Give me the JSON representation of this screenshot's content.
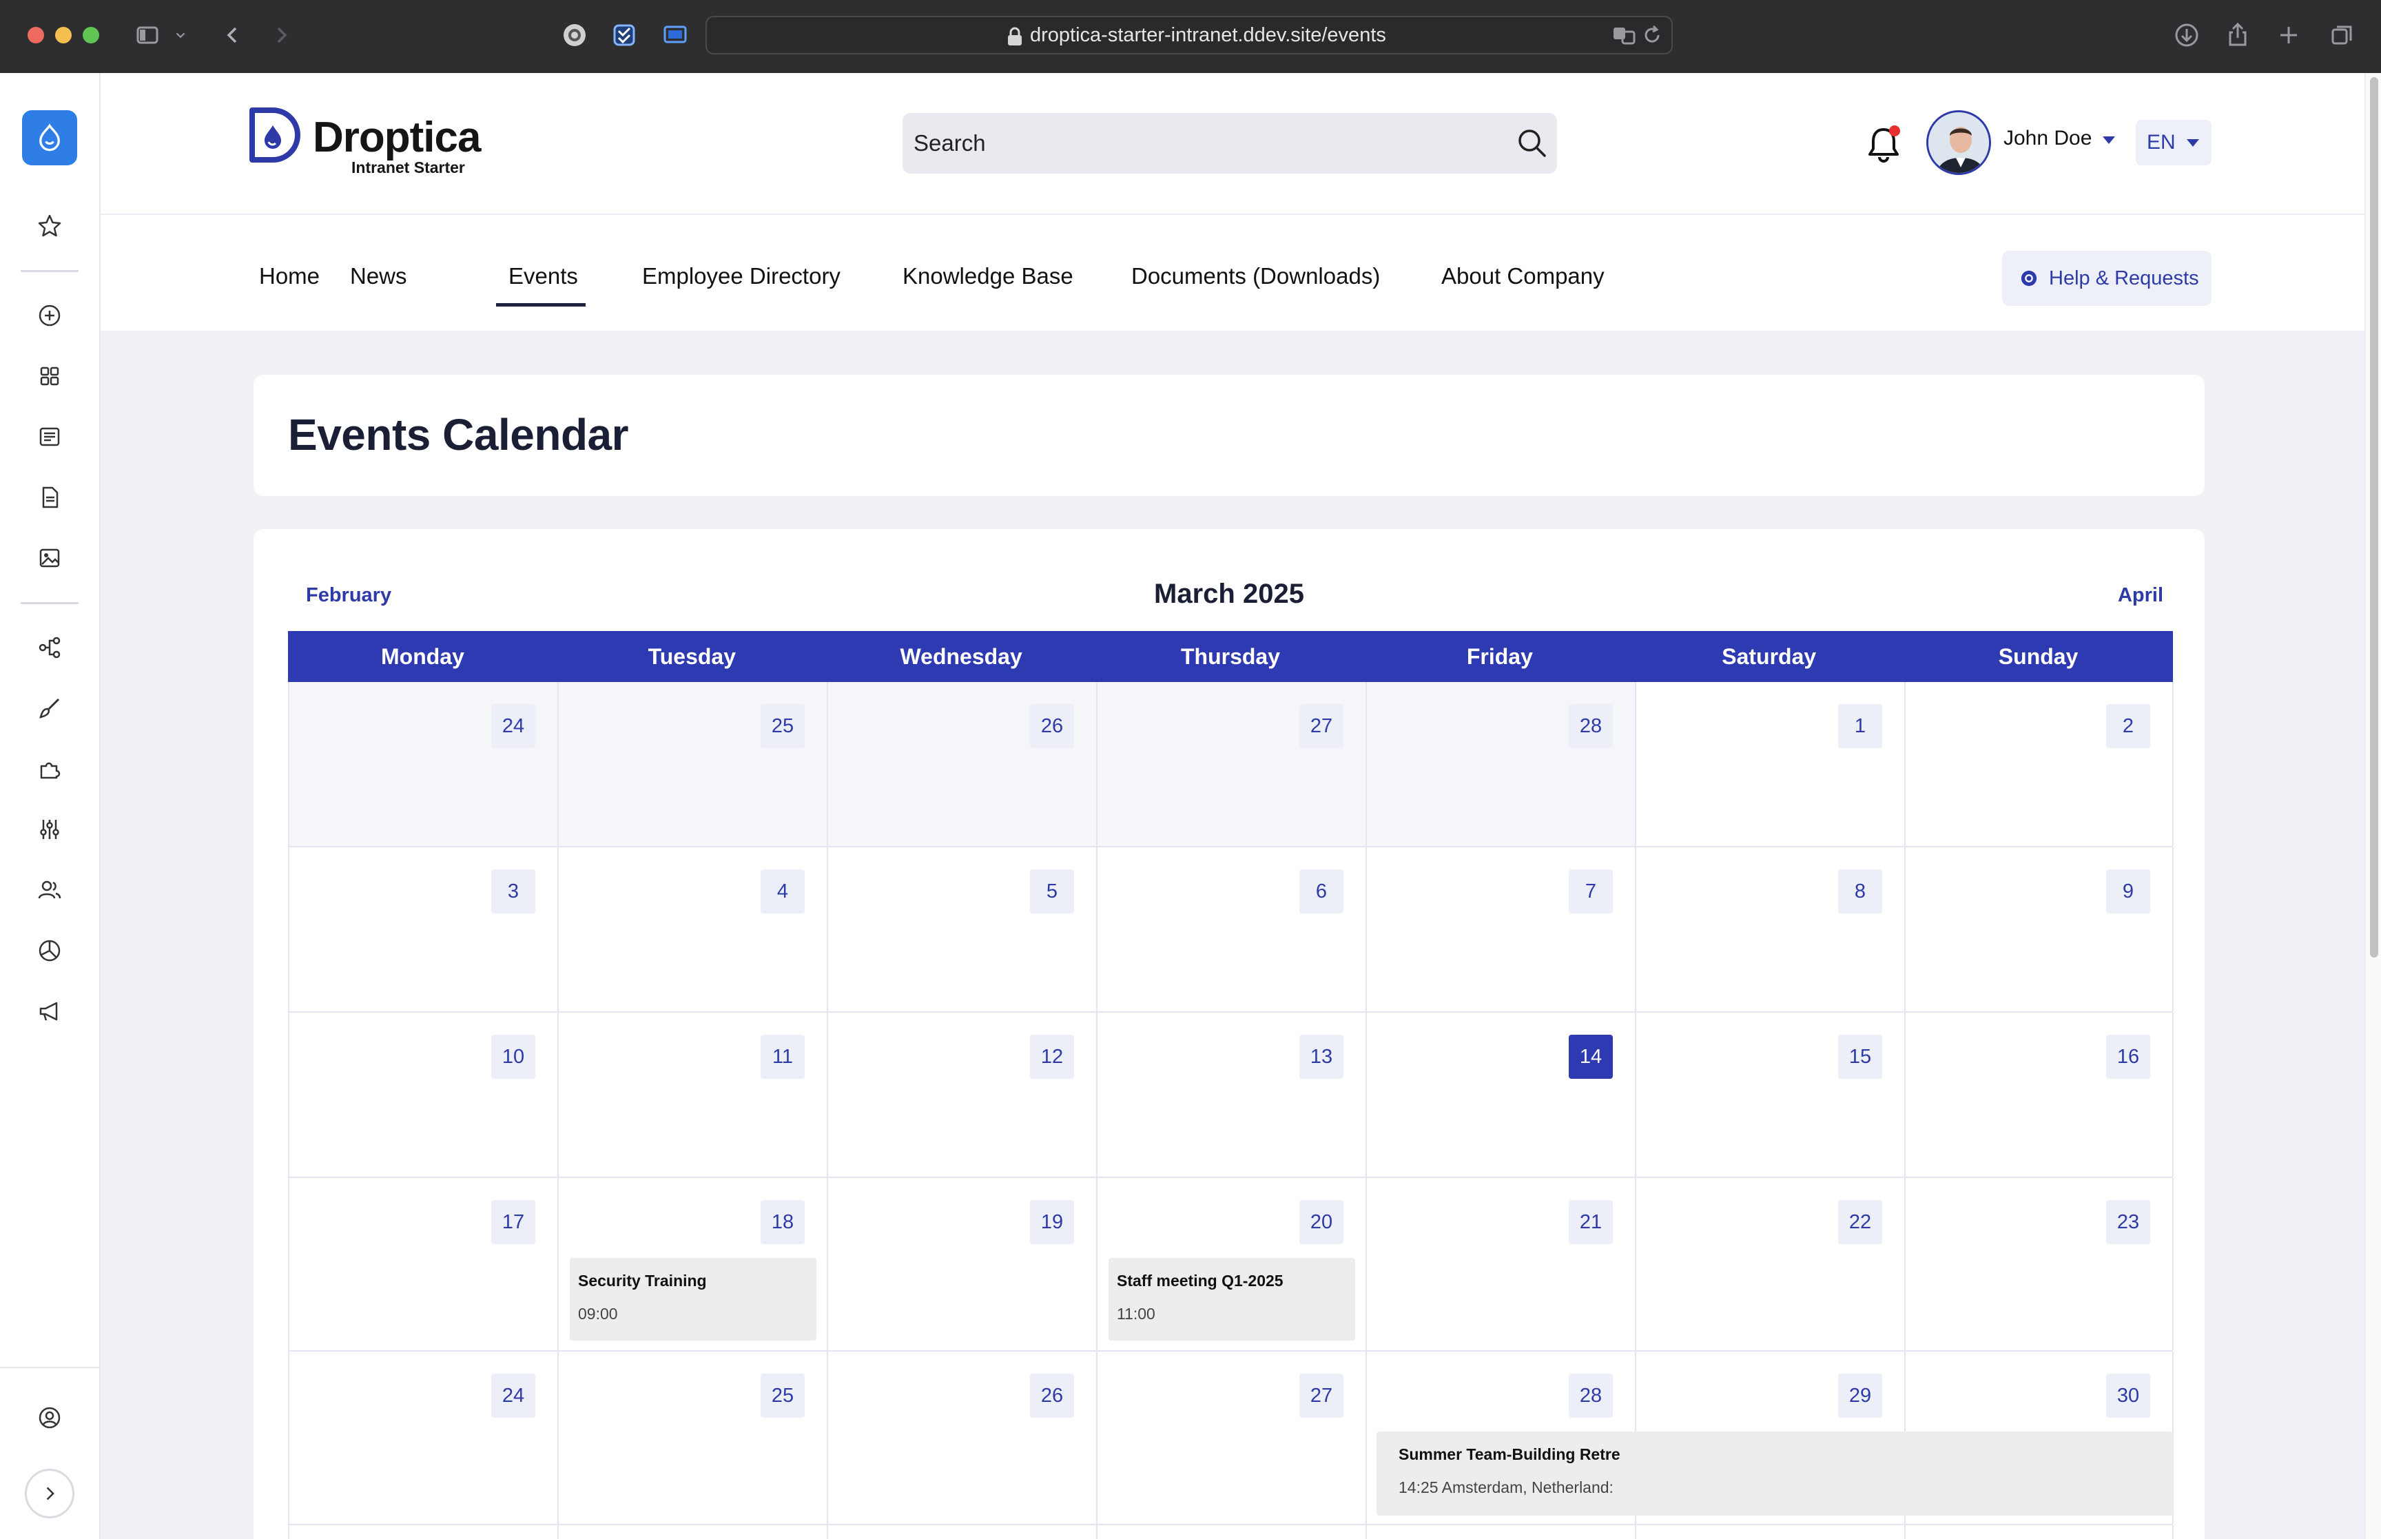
{
  "browser": {
    "url": "droptica-starter-intranet.ddev.site/events",
    "colors": {
      "chrome_bg": "#2e2e30",
      "close": "#ed6a5e",
      "minimize": "#f5bf4f",
      "zoom": "#61c554"
    }
  },
  "header": {
    "brand_name": "Droptica",
    "brand_subtitle": "Intranet Starter",
    "search_placeholder": "Search",
    "user_name": "John Doe",
    "language": "EN",
    "has_notification": true
  },
  "nav": {
    "items": [
      {
        "label": "Home",
        "active": false
      },
      {
        "label": "News",
        "active": false
      },
      {
        "label": "Events",
        "active": true
      },
      {
        "label": "Employee Directory",
        "active": false
      },
      {
        "label": "Knowledge Base",
        "active": false
      },
      {
        "label": "Documents (Downloads)",
        "active": false
      },
      {
        "label": "About Company",
        "active": false
      }
    ],
    "help_label": "Help & Requests"
  },
  "page": {
    "title": "Events Calendar"
  },
  "calendar": {
    "prev_month": "February",
    "month_title": "March 2025",
    "next_month": "April",
    "weekdays": [
      "Monday",
      "Tuesday",
      "Wednesday",
      "Thursday",
      "Friday",
      "Saturday",
      "Sunday"
    ],
    "weeks": [
      [
        "24",
        "25",
        "26",
        "27",
        "28",
        "1",
        "2"
      ],
      [
        "3",
        "4",
        "5",
        "6",
        "7",
        "8",
        "9"
      ],
      [
        "10",
        "11",
        "12",
        "13",
        "14",
        "15",
        "16"
      ],
      [
        "17",
        "18",
        "19",
        "20",
        "21",
        "22",
        "23"
      ],
      [
        "24",
        "25",
        "26",
        "27",
        "28",
        "29",
        "30"
      ]
    ],
    "today": "14",
    "events": [
      {
        "title": "Security Training",
        "time": "09:00"
      },
      {
        "title": "Staff meeting Q1-2025",
        "time": "11:00"
      },
      {
        "title": "Summer Team-Building Retre",
        "time": "14:25 Amsterdam, Netherland:"
      }
    ],
    "colors": {
      "header_bg": "#2e3ab1",
      "accent": "#2d3aa8",
      "event_bg": "#ededf0"
    }
  },
  "admin_toolbar": {
    "icons": [
      "drupal-icon",
      "star-icon",
      "add-icon",
      "grid-icon",
      "list-icon",
      "document-icon",
      "media-icon",
      "structure-icon",
      "brush-icon",
      "extend-icon",
      "config-icon",
      "people-icon",
      "reports-icon",
      "announce-icon",
      "user-icon",
      "expand-icon"
    ]
  }
}
